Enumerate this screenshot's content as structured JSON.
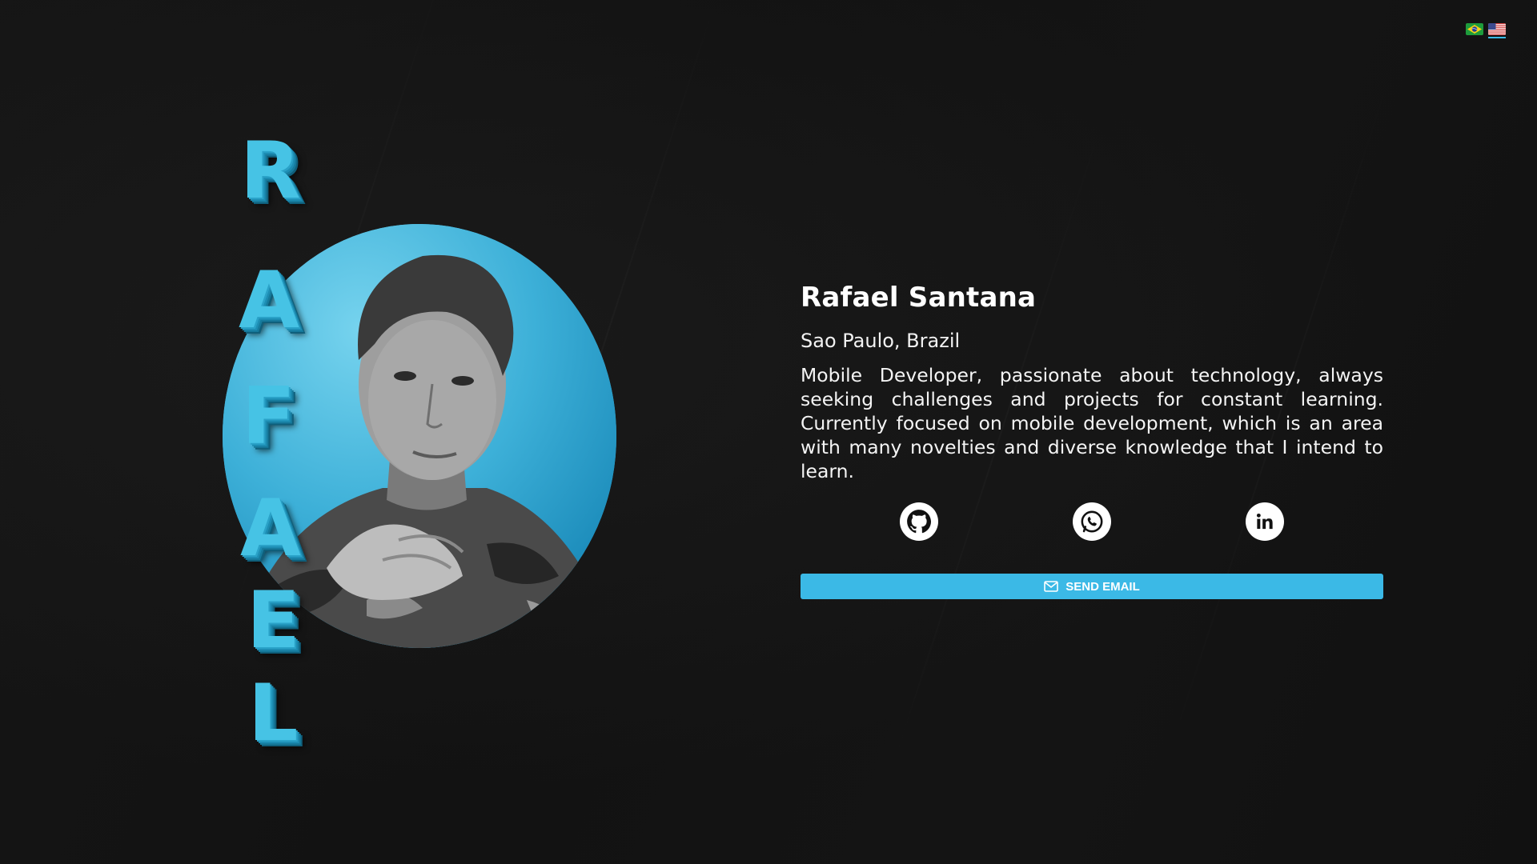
{
  "language_switch": {
    "options": [
      {
        "code": "pt-BR",
        "icon": "brazil-flag-icon"
      },
      {
        "code": "en-US",
        "icon": "usa-flag-icon",
        "active": true
      }
    ]
  },
  "hero": {
    "vertical_name_letters": [
      "R",
      "A",
      "F",
      "A",
      "E",
      "L"
    ],
    "accent_color": "#46c3e5",
    "avatar_background": "#3fb2d9"
  },
  "profile": {
    "name": "Rafael Santana",
    "location": "Sao Paulo, Brazil",
    "bio": "Mobile Developer, passionate about technology, always seeking challenges and projects for constant learning. Currently focused on mobile development, which is an area with many novelties and diverse knowledge that I intend to learn."
  },
  "socials": [
    {
      "icon": "github-icon"
    },
    {
      "icon": "whatsapp-icon"
    },
    {
      "icon": "linkedin-icon"
    }
  ],
  "cta": {
    "label": "SEND EMAIL",
    "icon": "mail-icon",
    "color": "#3bb9e6"
  }
}
